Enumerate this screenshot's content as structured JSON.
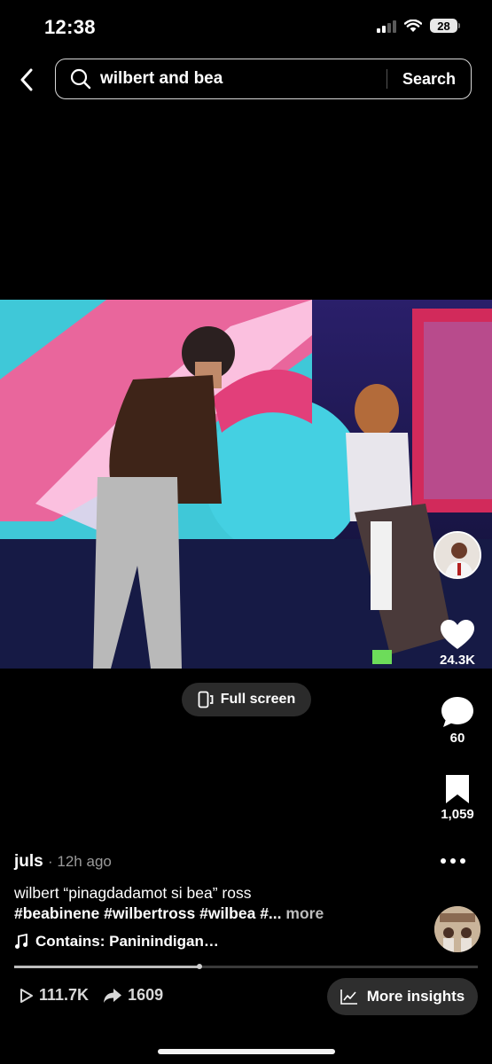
{
  "status_bar": {
    "time": "12:38",
    "battery": "28"
  },
  "search": {
    "query": "wilbert and bea",
    "button_label": "Search"
  },
  "video": {
    "fullscreen_label": "Full screen"
  },
  "actions": {
    "likes": "24.3K",
    "comments": "60",
    "saves": "1,059"
  },
  "post": {
    "author": "juls",
    "time_ago": "· 12h ago",
    "caption": "wilbert “pinagdadamot si bea” ross",
    "hashtags": "#beabinene #wilbertross #wilbea #...",
    "more_label": "more",
    "music": "Contains: Paninindigan…",
    "progress_fraction": 0.4
  },
  "footer": {
    "plays": "111.7K",
    "shares": "1609",
    "insights_label": "More insights"
  },
  "icons": [
    "back-icon",
    "search-icon",
    "fullscreen-icon",
    "heart-icon",
    "comment-icon",
    "bookmark-icon",
    "more-dots-icon",
    "music-note-icon",
    "play-icon",
    "share-icon",
    "insights-chart-icon"
  ]
}
